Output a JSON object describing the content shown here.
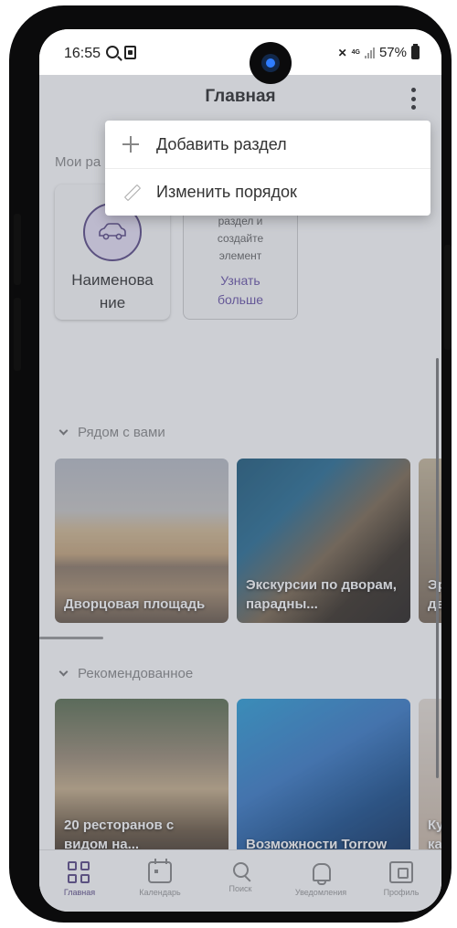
{
  "status_bar": {
    "time": "16:55",
    "battery": "57%",
    "network": "4G"
  },
  "header": {
    "title": "Главная"
  },
  "menu": {
    "items": [
      {
        "label": "Добавить раздел",
        "icon": "plus-icon"
      },
      {
        "label": "Изменить порядок",
        "icon": "pencil-icon"
      }
    ]
  },
  "my_sections": {
    "label": "Мои ра",
    "card_label": "Наименова ние",
    "hint_text": "раздел и создайте элемент",
    "hint_link": "Узнать больше"
  },
  "nearby": {
    "label": "Рядом с вами",
    "items": [
      {
        "title": "Дворцовая площадь"
      },
      {
        "title": "Экскурсии по дворам, парадны..."
      },
      {
        "title": "Эр дв"
      }
    ]
  },
  "recommended": {
    "label": "Рекомендованное",
    "items": [
      {
        "title": "20 ресторанов с видом на..."
      },
      {
        "title": "Возможности Torrow"
      },
      {
        "title": "Ку ка"
      }
    ]
  },
  "bottom_nav": {
    "items": [
      {
        "label": "Главная",
        "icon": "home-grid-icon",
        "active": true
      },
      {
        "label": "Календарь",
        "icon": "calendar-icon",
        "active": false
      },
      {
        "label": "Поиск",
        "icon": "search-icon",
        "active": false
      },
      {
        "label": "Уведомления",
        "icon": "bell-icon",
        "active": false
      },
      {
        "label": "Профиль",
        "icon": "profile-icon",
        "active": false
      }
    ]
  },
  "colors": {
    "accent": "#5c4b87",
    "link": "#6a55a8",
    "scrim": "rgba(90,96,112,0.30)"
  }
}
